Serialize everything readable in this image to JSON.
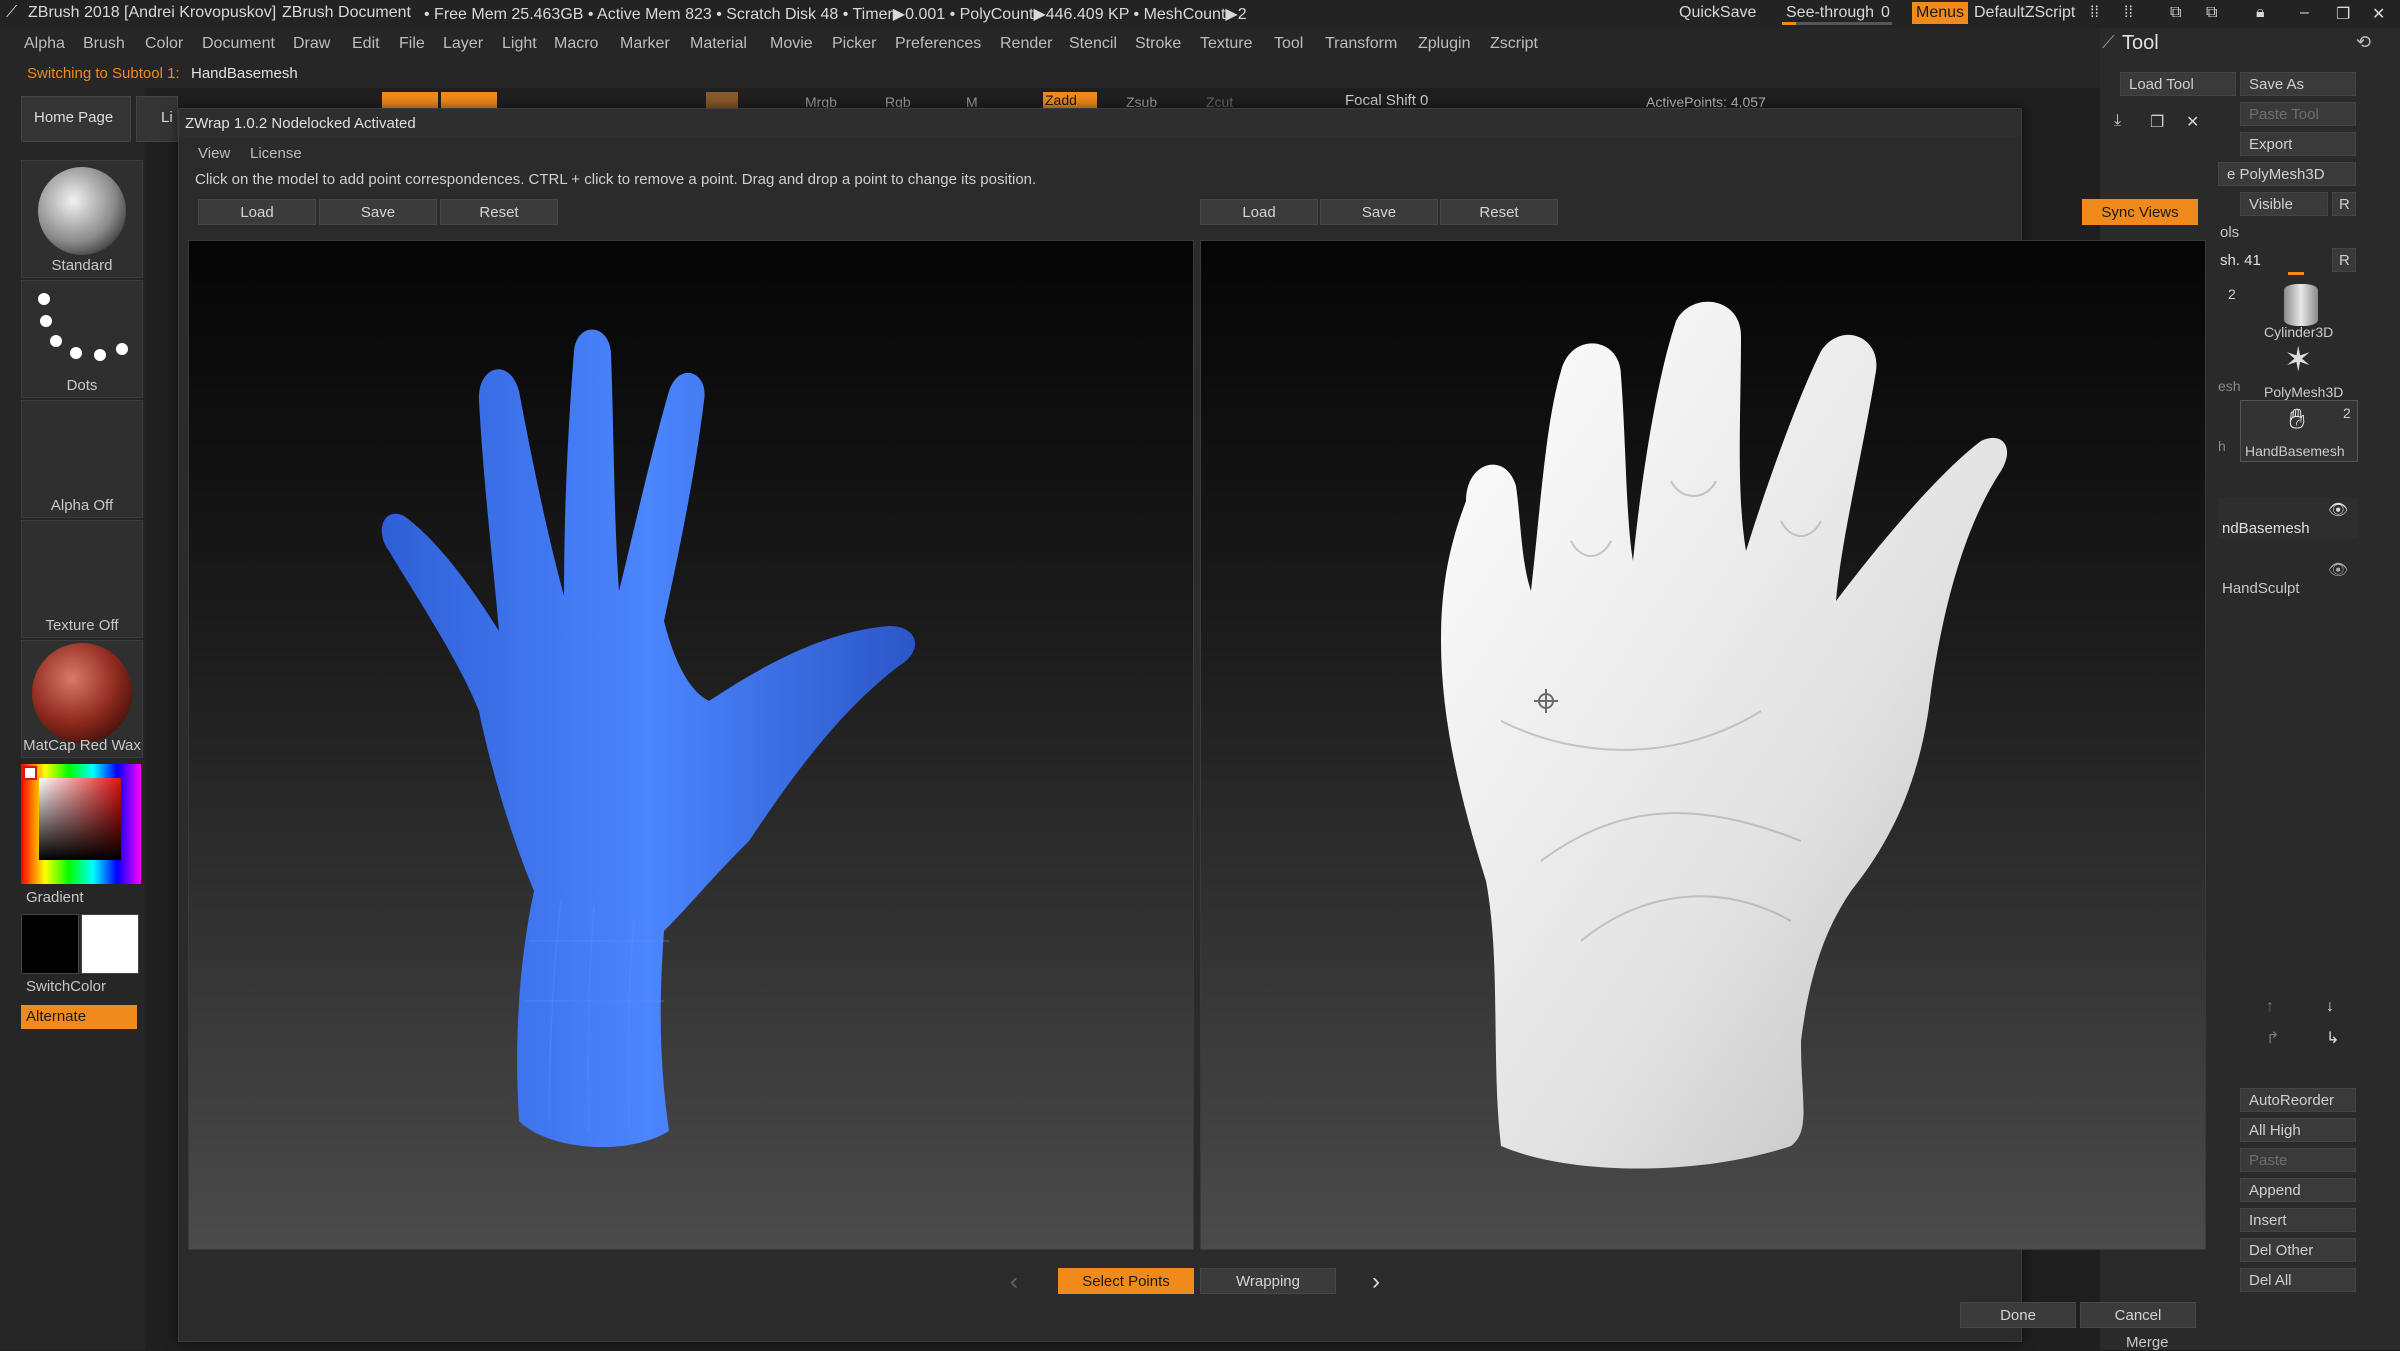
{
  "titlebar": {
    "app_title": "ZBrush 2018 [Andrei Krovopuskov]",
    "document": "ZBrush Document",
    "stats": "• Free Mem 25.463GB • Active Mem 823 • Scratch Disk 48 • Timer▶0.001 • PolyCount▶446.409 KP • MeshCount▶2",
    "quicksave": "QuickSave",
    "see_through_label": "See-through",
    "see_through_value": "0",
    "menus": "Menus",
    "script": "DefaultZScript"
  },
  "menubar": [
    "Alpha",
    "Brush",
    "Color",
    "Document",
    "Draw",
    "Edit",
    "File",
    "Layer",
    "Light",
    "Macro",
    "Marker",
    "Material",
    "Movie",
    "Picker",
    "Preferences",
    "Render",
    "Stencil",
    "Stroke",
    "Texture",
    "Tool",
    "Transform",
    "Zplugin",
    "Zscript"
  ],
  "status": {
    "prefix": "Switching to Subtool 1:",
    "subtool": "HandBasemesh"
  },
  "top_toolbar": {
    "mrgb": "Mrgb",
    "rgb": "Rgb",
    "m": "M",
    "zadd": "Zadd",
    "zsub": "Zsub",
    "zcut": "Zcut",
    "focal_shift": "Focal Shift 0",
    "active_points": "ActivePoints: 4,057"
  },
  "left_shelf": {
    "home_page": "Home Page",
    "lightbox": "Li",
    "brush": "Standard",
    "stroke": "Dots",
    "alpha": "Alpha Off",
    "texture": "Texture Off",
    "material": "MatCap Red Wax",
    "gradient": "Gradient",
    "switch_color": "SwitchColor",
    "alternate": "Alternate"
  },
  "right_panel": {
    "header": "Tool",
    "load_tool": "Load Tool",
    "save_as": "Save As",
    "paste_tool": "Paste Tool",
    "export": "Export",
    "polymesh_partial": "e PolyMesh3D",
    "visible": "Visible",
    "r": "R",
    "tools_partial": "ols",
    "mesh_partial": "sh. 41",
    "r2": "R",
    "count_two": "2",
    "cylinder": "Cylinder3D",
    "polymesh": "PolyMesh3D",
    "esh_partial": "esh",
    "h_partial": "h",
    "handbasemesh": "HandBasemesh",
    "count_handbasemesh": "2",
    "subtool1": "ndBasemesh",
    "subtool2": "HandSculpt",
    "autoreorder": "AutoReorder",
    "all_high": "All High",
    "paste": "Paste",
    "append": "Append",
    "insert": "Insert",
    "del_other": "Del Other",
    "del_all": "Del All",
    "merge": "Merge"
  },
  "dialog": {
    "title": "ZWrap 1.0.2  Nodelocked Activated",
    "menu": [
      "View",
      "License"
    ],
    "instructions": "Click on the model to add point correspondences. CTRL + click to remove a point. Drag and drop a point to change its position.",
    "left_buttons": [
      "Load",
      "Save",
      "Reset"
    ],
    "right_buttons": [
      "Load",
      "Save",
      "Reset"
    ],
    "sync_views": "Sync Views",
    "mode_select": "Select Points",
    "mode_wrap": "Wrapping",
    "done": "Done",
    "cancel": "Cancel"
  },
  "colors": {
    "accent": "#f08a1c",
    "basemesh": "#3c74f2",
    "sculpt": "#e6e6e6"
  }
}
